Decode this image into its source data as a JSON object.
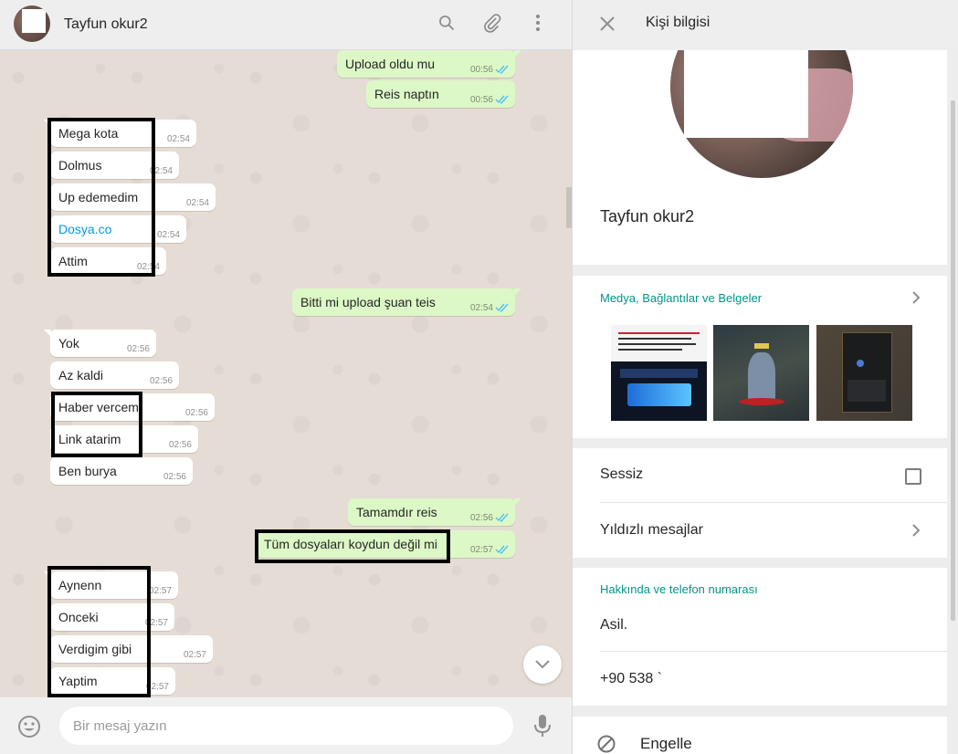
{
  "chat": {
    "contact_name": "Tayfun okur2",
    "icons": {
      "search": "search-icon",
      "attach": "paperclip-icon",
      "menu": "more-vert-icon"
    },
    "messages": [
      {
        "text": "Upload oldu mu",
        "time": "00:56",
        "dir": "out",
        "status": "read"
      },
      {
        "text": "Reis naptın",
        "time": "00:56",
        "dir": "out",
        "status": "read"
      },
      {
        "text": "Mega kota",
        "time": "02:54",
        "dir": "in"
      },
      {
        "text": "Dolmus",
        "time": "02:54",
        "dir": "in"
      },
      {
        "text": "Up edemedim",
        "time": "02:54",
        "dir": "in"
      },
      {
        "text": "Dosya.co",
        "time": "02:54",
        "dir": "in",
        "is_link": true
      },
      {
        "text": "Attim",
        "time": "02:54",
        "dir": "in"
      },
      {
        "text": "Bitti mi upload şuan teis",
        "time": "02:54",
        "dir": "out",
        "status": "read"
      },
      {
        "text": "Yok",
        "time": "02:56",
        "dir": "in"
      },
      {
        "text": "Az kaldi",
        "time": "02:56",
        "dir": "in"
      },
      {
        "text": "Haber vercem",
        "time": "02:56",
        "dir": "in"
      },
      {
        "text": "Link atarim",
        "time": "02:56",
        "dir": "in"
      },
      {
        "text": "Ben burya",
        "time": "02:56",
        "dir": "in"
      },
      {
        "text": "Tamamdır reis",
        "time": "02:56",
        "dir": "out",
        "status": "read"
      },
      {
        "text": "Tüm dosyaları koydun değil mi",
        "time": "02:57",
        "dir": "out",
        "status": "read"
      },
      {
        "text": "Aynenn",
        "time": "02:57",
        "dir": "in"
      },
      {
        "text": "Onceki",
        "time": "02:57",
        "dir": "in"
      },
      {
        "text": "Verdigim gibi",
        "time": "02:57",
        "dir": "in"
      },
      {
        "text": "Yaptim",
        "time": "02:57",
        "dir": "in"
      }
    ],
    "compose_placeholder": "Bir mesaj yazın"
  },
  "info": {
    "title": "Kişi bilgisi",
    "name": "Tayfun okur2",
    "media_label": "Medya, Bağlantılar ve Belgeler",
    "media_thumbs": [
      "media-thumb-otp-poster",
      "media-thumb-game-character",
      "media-thumb-game-inventory"
    ],
    "mute_label": "Sessiz",
    "mute_checked": false,
    "starred_label": "Yıldızlı mesajlar",
    "about_label": "Hakkında ve telefon numarası",
    "about_text": "Asil.",
    "phone": "+90 538 `",
    "block_label": "Engelle"
  },
  "colors": {
    "outgoing_bubble": "#dcf8c6",
    "incoming_bubble": "#ffffff",
    "accent": "#009688",
    "link": "#039be5",
    "read_tick": "#4fc3f7"
  }
}
